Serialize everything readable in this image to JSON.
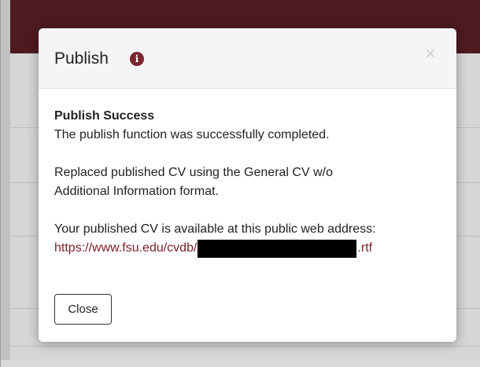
{
  "modal": {
    "title": "Publish",
    "info_icon": "info-circle-icon",
    "close_icon_glyph": "×",
    "heading": "Publish Success",
    "message": "The publish function was successfully completed.",
    "replaced_line_1": "Replaced published CV using the General CV w/o",
    "replaced_line_2": "Additional Information format.",
    "available_text": "Your published CV is available at this public web address:",
    "url_prefix": "https://www.fsu.edu/cvdb/",
    "url_suffix": ".rtf",
    "close_button_label": "Close"
  },
  "colors": {
    "brand_header": "#4d1a20",
    "link": "#7a1f2b",
    "info_icon": "#7a2530"
  }
}
